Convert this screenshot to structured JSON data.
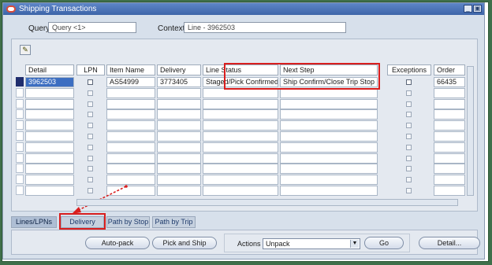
{
  "window": {
    "title": "Shipping Transactions"
  },
  "query": {
    "label": "Query",
    "value": "Query <1>"
  },
  "context": {
    "label": "Context",
    "value": "Line - 3962503"
  },
  "columns": [
    "Detail",
    "LPN",
    "Item Name",
    "Delivery",
    "Line Status",
    "Next Step",
    "Exceptions",
    "Order"
  ],
  "rows": [
    {
      "detail": "3962503",
      "item": "AS54999",
      "delivery": "3773405",
      "status": "Staged/Pick Confirmed",
      "next": "Ship Confirm/Close Trip Stop",
      "order": "66435"
    }
  ],
  "tabs": [
    "Lines/LPNs",
    "Delivery",
    "Path by Stop",
    "Path by Trip"
  ],
  "buttons": {
    "autopack": "Auto-pack",
    "pickship": "Pick and Ship",
    "actions_label": "Actions",
    "actions_value": "Unpack",
    "go": "Go",
    "detail": "Detail..."
  },
  "colors": {
    "highlight": "#d91e1e",
    "titlebar": "#4a72b8",
    "selected": "#3c6ec1"
  }
}
